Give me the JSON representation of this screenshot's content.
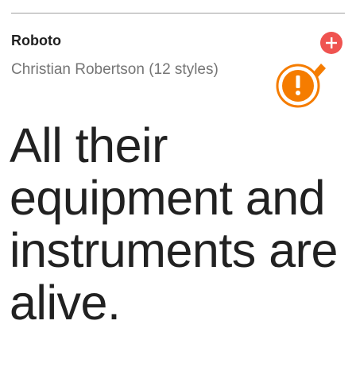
{
  "card": {
    "font_name": "Roboto",
    "designer_info": "Christian Robertson (12 styles)",
    "sample_text": "All their equipment and instruments are alive."
  },
  "icons": {
    "add": "plus-circle-icon",
    "alert": "exclamation-badge-icon"
  },
  "colors": {
    "add_button": "#ef5350",
    "alert_badge": "#f57c00",
    "title_text": "#212121",
    "subtitle_text": "#757575"
  }
}
